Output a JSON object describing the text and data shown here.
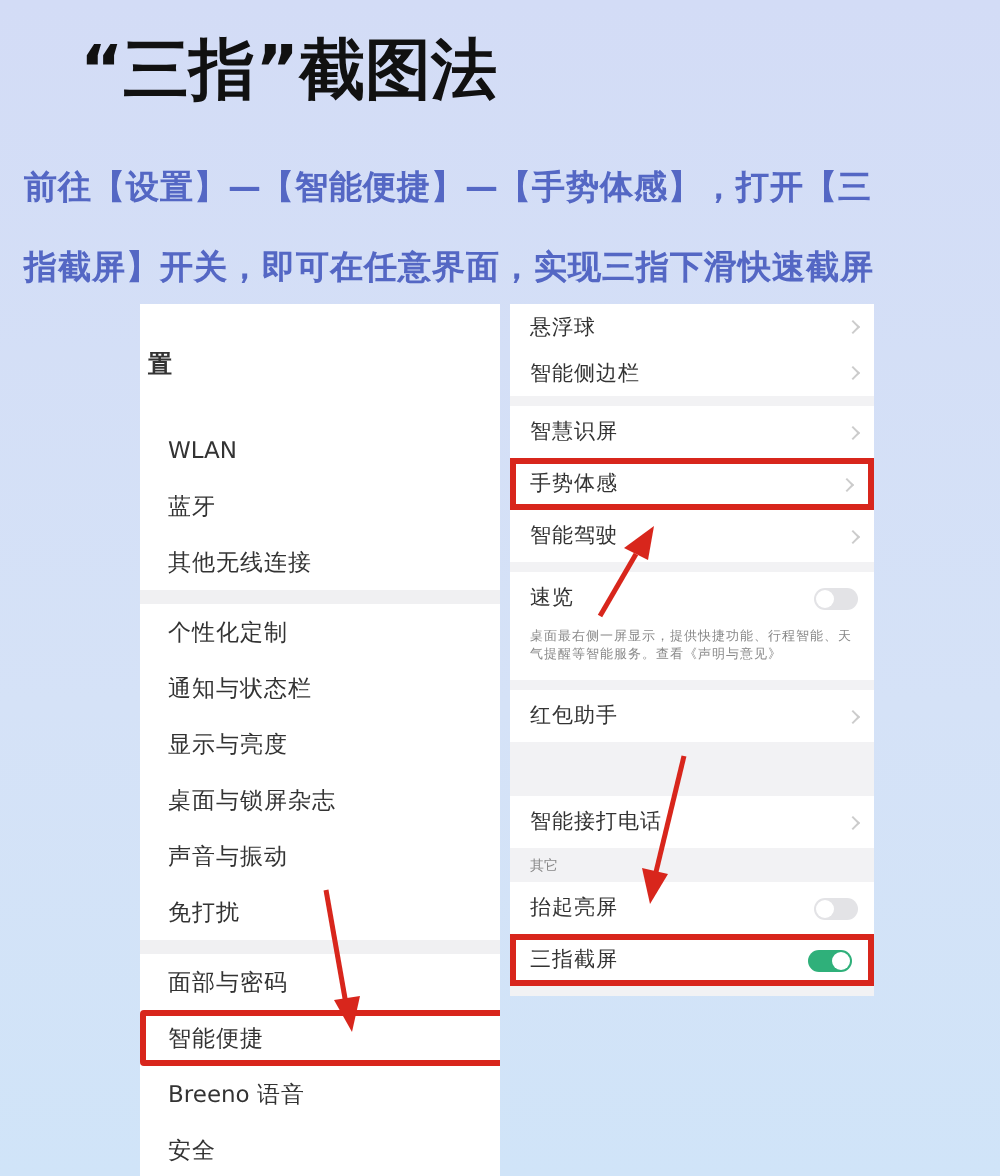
{
  "title": "“三指”截图法",
  "instruction_lines": [
    "前往【设置】—【智能便捷】—【手势体感】，打开【三",
    "指截屏】开关，即可在任意界面，实现三指下滑快速截屏"
  ],
  "settings_screen": {
    "header": "置",
    "groups": [
      [
        {
          "label": "WLAN",
          "highlighted": false
        },
        {
          "label": "蓝牙",
          "highlighted": false
        },
        {
          "label": "其他无线连接",
          "highlighted": false
        }
      ],
      [
        {
          "label": "个性化定制",
          "highlighted": false
        },
        {
          "label": "通知与状态栏",
          "highlighted": false
        },
        {
          "label": "显示与亮度",
          "highlighted": false
        },
        {
          "label": "桌面与锁屏杂志",
          "highlighted": false
        },
        {
          "label": "声音与振动",
          "highlighted": false
        },
        {
          "label": "免打扰",
          "highlighted": false
        }
      ],
      [
        {
          "label": "面部与密码",
          "highlighted": false
        },
        {
          "label": "智能便捷",
          "highlighted": true
        },
        {
          "label": "Breeno 语音",
          "highlighted": false
        },
        {
          "label": "安全",
          "highlighted": false
        }
      ]
    ]
  },
  "shortcuts_screen": {
    "groups": [
      [
        {
          "kind": "link",
          "label": "悬浮球",
          "highlighted": false
        },
        {
          "kind": "link",
          "label": "智能侧边栏",
          "highlighted": false
        }
      ],
      [
        {
          "kind": "link",
          "label": "智慧识屏",
          "highlighted": false
        },
        {
          "kind": "link",
          "label": "手势体感",
          "highlighted": true
        },
        {
          "kind": "link",
          "label": "智能驾驶",
          "highlighted": false
        }
      ],
      [
        {
          "kind": "toggle",
          "label": "速览",
          "on": false,
          "highlighted": false
        },
        {
          "kind": "note",
          "label": "桌面最右侧一屏显示，提供快捷功能、行程智能、天气提醒等智能服务。查看《声明与意见》"
        }
      ],
      [
        {
          "kind": "link",
          "label": "红包助手",
          "highlighted": false
        }
      ],
      [
        {
          "kind": "link",
          "label": "智能接打电话",
          "highlighted": false
        },
        {
          "kind": "header",
          "label": "其它"
        },
        {
          "kind": "toggle",
          "label": "抬起亮屏",
          "on": false,
          "highlighted": false
        },
        {
          "kind": "toggle",
          "label": "三指截屏",
          "on": true,
          "highlighted": true
        }
      ]
    ]
  }
}
